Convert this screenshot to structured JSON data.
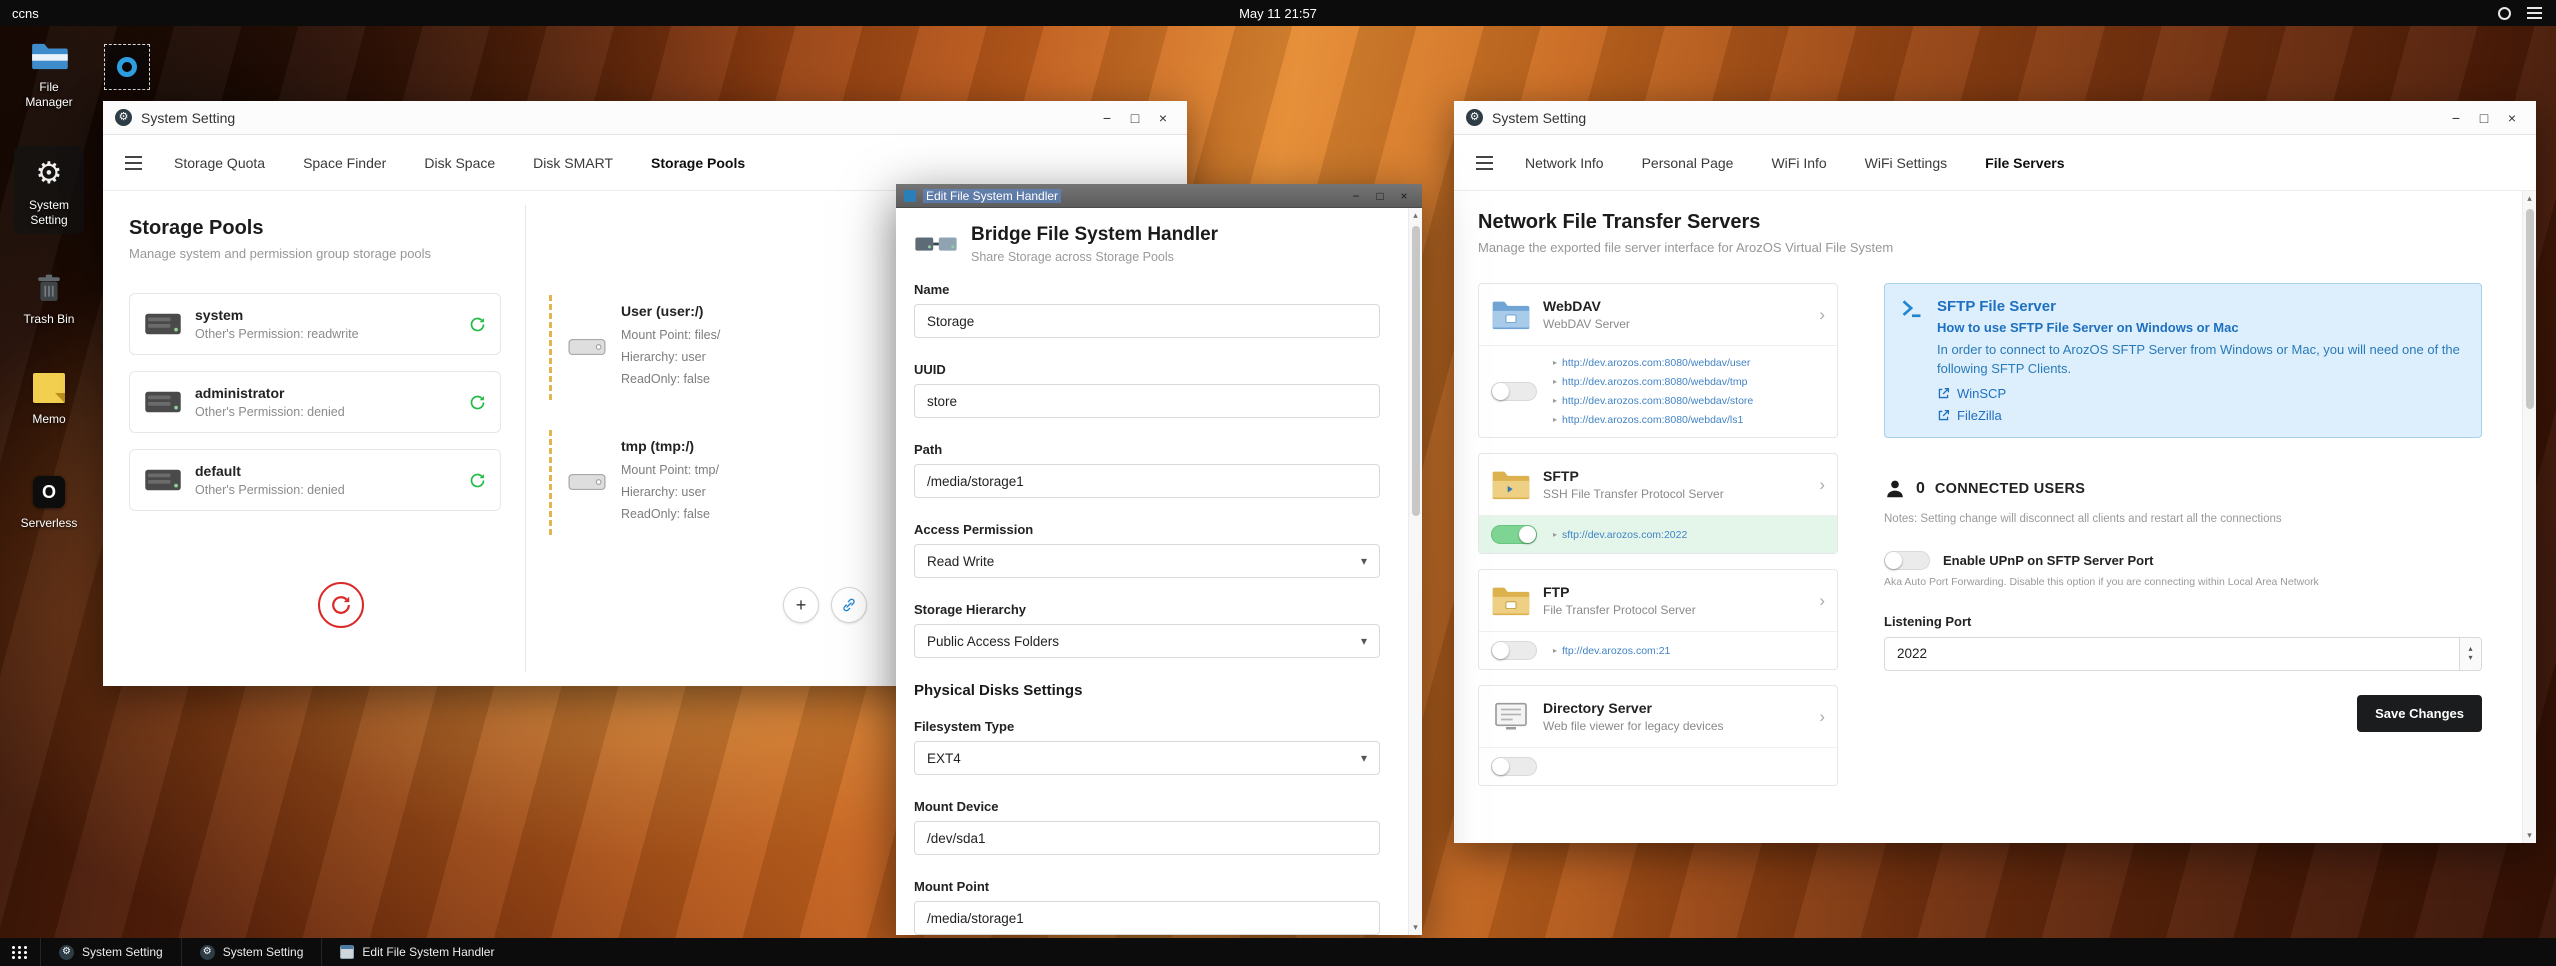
{
  "topbar": {
    "host": "ccns",
    "clock": "May 11 21:57"
  },
  "desktop": {
    "icons": [
      {
        "label": "File Manager"
      },
      {
        "label": "System Setting"
      },
      {
        "label": "Trash Bin"
      },
      {
        "label": "Memo"
      },
      {
        "label": "Serverless",
        "glyph": "O"
      }
    ]
  },
  "storage_window": {
    "title": "System Setting",
    "tabs": [
      {
        "label": "Storage Quota"
      },
      {
        "label": "Space Finder"
      },
      {
        "label": "Disk Space"
      },
      {
        "label": "Disk SMART"
      },
      {
        "label": "Storage Pools"
      }
    ],
    "heading": "Storage Pools",
    "subheading": "Manage system and permission group storage pools",
    "pools": [
      {
        "name": "system",
        "permission": "Other's Permission: readwrite"
      },
      {
        "name": "administrator",
        "permission": "Other's Permission: denied"
      },
      {
        "name": "default",
        "permission": "Other's Permission: denied"
      }
    ],
    "mounts": [
      {
        "name": "User (user:/)",
        "mount_point": "Mount Point: files/",
        "hierarchy": "Hierarchy: user",
        "readonly": "ReadOnly: false"
      },
      {
        "name": "tmp (tmp:/)",
        "mount_point": "Mount Point: tmp/",
        "hierarchy": "Hierarchy: user",
        "readonly": "ReadOnly: false"
      }
    ]
  },
  "editor_window": {
    "title": "Edit File System Handler",
    "heading": "Bridge File System Handler",
    "subheading": "Share Storage across Storage Pools",
    "fields": {
      "name": {
        "label": "Name",
        "value": "Storage"
      },
      "uuid": {
        "label": "UUID",
        "value": "store"
      },
      "path": {
        "label": "Path",
        "value": "/media/storage1"
      },
      "access": {
        "label": "Access Permission",
        "value": "Read Write"
      },
      "hierarchy": {
        "label": "Storage Hierarchy",
        "value": "Public Access Folders"
      },
      "section": "Physical Disks Settings",
      "fstype": {
        "label": "Filesystem Type",
        "value": "EXT4"
      },
      "mount_device": {
        "label": "Mount Device",
        "value": "/dev/sda1"
      },
      "mount_point": {
        "label": "Mount Point",
        "value": "/media/storage1"
      }
    }
  },
  "network_window": {
    "title": "System Setting",
    "tabs": [
      {
        "label": "Network Info"
      },
      {
        "label": "Personal Page"
      },
      {
        "label": "WiFi Info"
      },
      {
        "label": "WiFi Settings"
      },
      {
        "label": "File Servers"
      }
    ],
    "heading": "Network File Transfer Servers",
    "subheading": "Manage the exported file server interface for ArozOS Virtual File System",
    "servers": [
      {
        "name": "WebDAV",
        "desc": "WebDAV Server",
        "links": [
          "http://dev.arozos.com:8080/webdav/user",
          "http://dev.arozos.com:8080/webdav/tmp",
          "http://dev.arozos.com:8080/webdav/store",
          "http://dev.arozos.com:8080/webdav/ls1"
        ]
      },
      {
        "name": "SFTP",
        "desc": "SSH File Transfer Protocol Server",
        "links": [
          "sftp://dev.arozos.com:2022"
        ]
      },
      {
        "name": "FTP",
        "desc": "File Transfer Protocol Server",
        "links": [
          "ftp://dev.arozos.com:21"
        ]
      },
      {
        "name": "Directory Server",
        "desc": "Web file viewer for legacy devices"
      }
    ],
    "sftp_info": {
      "title": "SFTP File Server",
      "subtitle": "How to use SFTP File Server on Windows or Mac",
      "body": "In order to connect to ArozOS SFTP Server from Windows or Mac, you will need one of the following SFTP Clients.",
      "clients": [
        {
          "label": "WinSCP"
        },
        {
          "label": "FileZilla"
        }
      ]
    },
    "connected_users": {
      "count": "0",
      "label": "CONNECTED USERS",
      "note": "Notes: Setting change will disconnect all clients and restart all the connections"
    },
    "upnp": {
      "label": "Enable UPnP on SFTP Server Port",
      "note": "Aka Auto Port Forwarding. Disable this option if you are connecting within Local Area Network"
    },
    "listening_port": {
      "label": "Listening Port",
      "value": "2022"
    },
    "save_button": "Save Changes"
  },
  "taskbar": {
    "items": [
      {
        "label": "System Setting"
      },
      {
        "label": "System Setting"
      },
      {
        "label": "Edit File System Handler"
      }
    ]
  },
  "icons": {
    "gear": "⚙",
    "chevron_right": "›",
    "caret_down": "▾",
    "caret_up": "▴",
    "link_bullet": "▸",
    "minimize": "−",
    "maximize": "□",
    "close": "×",
    "plus": "+"
  },
  "colors": {
    "accent_blue": "#2185d0",
    "success_green": "#21ba45",
    "danger_red": "#db2828",
    "link_blue": "#4183c4",
    "info_bg": "#ddeffc"
  }
}
